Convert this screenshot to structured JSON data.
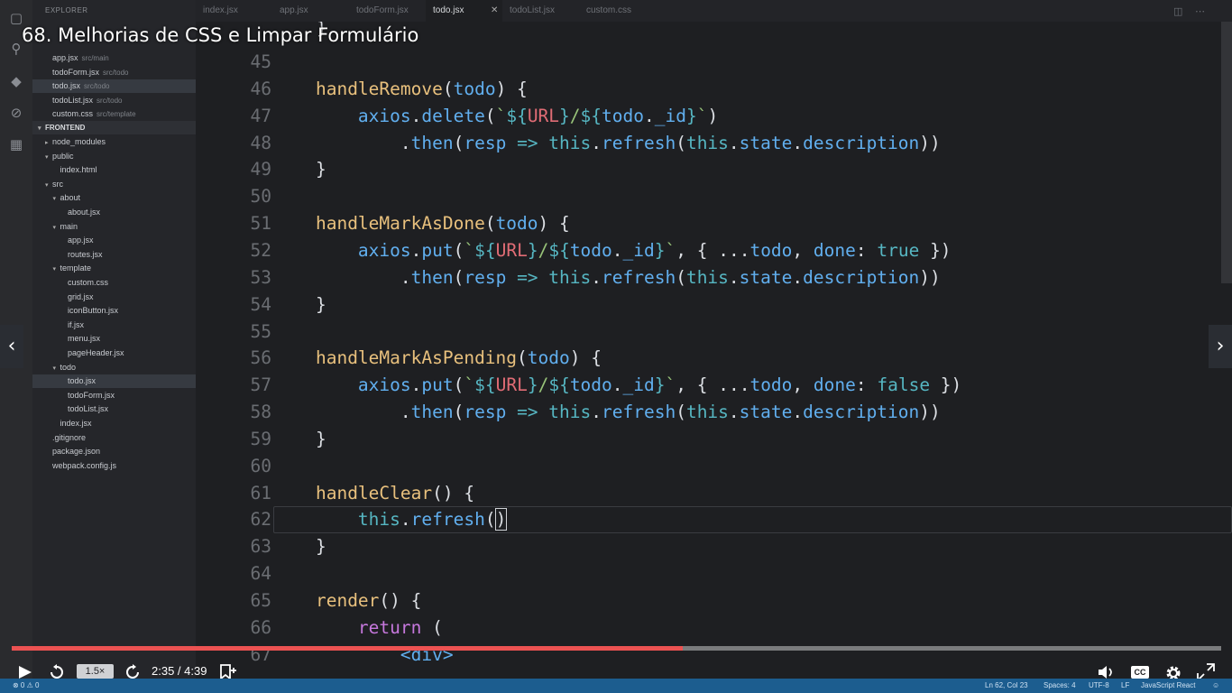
{
  "video": {
    "title": "68. Melhorias de CSS e Limpar Formulário",
    "speed": "1.5×",
    "time": "2:35 / 4:39",
    "progress": 0.555,
    "cc_label": "CC",
    "accent": "#ec5252"
  },
  "sidebar": {
    "header": "EXPLORER",
    "open_editors": [
      {
        "name": "app.jsx",
        "path": "src/main"
      },
      {
        "name": "todoForm.jsx",
        "path": "src/todo"
      },
      {
        "name": "todo.jsx",
        "path": "src/todo",
        "selected": true
      },
      {
        "name": "todoList.jsx",
        "path": "src/todo"
      },
      {
        "name": "custom.css",
        "path": "src/template"
      }
    ],
    "section": "FRONTEND",
    "tree": [
      {
        "name": "node_modules",
        "level": 0,
        "type": "folder-closed"
      },
      {
        "name": "public",
        "level": 0,
        "type": "folder-open"
      },
      {
        "name": "index.html",
        "level": 1,
        "type": "file"
      },
      {
        "name": "src",
        "level": 0,
        "type": "folder-open"
      },
      {
        "name": "about",
        "level": 1,
        "type": "folder-open"
      },
      {
        "name": "about.jsx",
        "level": 2,
        "type": "file"
      },
      {
        "name": "main",
        "level": 1,
        "type": "folder-open"
      },
      {
        "name": "app.jsx",
        "level": 2,
        "type": "file"
      },
      {
        "name": "routes.jsx",
        "level": 2,
        "type": "file"
      },
      {
        "name": "template",
        "level": 1,
        "type": "folder-open"
      },
      {
        "name": "custom.css",
        "level": 2,
        "type": "file"
      },
      {
        "name": "grid.jsx",
        "level": 2,
        "type": "file"
      },
      {
        "name": "iconButton.jsx",
        "level": 2,
        "type": "file"
      },
      {
        "name": "if.jsx",
        "level": 2,
        "type": "file"
      },
      {
        "name": "menu.jsx",
        "level": 2,
        "type": "file"
      },
      {
        "name": "pageHeader.jsx",
        "level": 2,
        "type": "file"
      },
      {
        "name": "todo",
        "level": 1,
        "type": "folder-open"
      },
      {
        "name": "todo.jsx",
        "level": 2,
        "type": "file",
        "selected": true
      },
      {
        "name": "todoForm.jsx",
        "level": 2,
        "type": "file"
      },
      {
        "name": "todoList.jsx",
        "level": 2,
        "type": "file"
      },
      {
        "name": "index.jsx",
        "level": 1,
        "type": "file"
      },
      {
        "name": ".gitignore",
        "level": 0,
        "type": "file"
      },
      {
        "name": "package.json",
        "level": 0,
        "type": "file"
      },
      {
        "name": "webpack.config.js",
        "level": 0,
        "type": "file"
      }
    ]
  },
  "tabs": [
    "index.jsx",
    "app.jsx",
    "todoForm.jsx",
    "todo.jsx",
    "todoList.jsx",
    "custom.css"
  ],
  "active_tab": "todo.jsx",
  "editor": {
    "lines": [
      {
        "n": "45",
        "tokens": []
      },
      {
        "n": "46",
        "tokens": [
          [
            "    ",
            "pun"
          ],
          [
            "handleRemove",
            "fn"
          ],
          [
            "(",
            "pun"
          ],
          [
            "todo",
            "prop"
          ],
          [
            ") {",
            "pun"
          ]
        ]
      },
      {
        "n": "47",
        "tokens": [
          [
            "        ",
            "pun"
          ],
          [
            "axios",
            "prop"
          ],
          [
            ".",
            "pun"
          ],
          [
            "delete",
            "prop"
          ],
          [
            "(",
            "pun"
          ],
          [
            "`",
            "str"
          ],
          [
            "${",
            "tpl"
          ],
          [
            "URL",
            "var"
          ],
          [
            "}",
            "tpl"
          ],
          [
            "/",
            "str"
          ],
          [
            "${",
            "tpl"
          ],
          [
            "todo",
            "prop"
          ],
          [
            ".",
            "pun"
          ],
          [
            "_id",
            "prop"
          ],
          [
            "}",
            "tpl"
          ],
          [
            "`",
            "str"
          ],
          [
            ")",
            "pun"
          ]
        ]
      },
      {
        "n": "48",
        "tokens": [
          [
            "            .",
            "pun"
          ],
          [
            "then",
            "prop"
          ],
          [
            "(",
            "pun"
          ],
          [
            "resp",
            "prop"
          ],
          [
            " ",
            "pun"
          ],
          [
            "=>",
            "arrow"
          ],
          [
            " ",
            "pun"
          ],
          [
            "this",
            "const"
          ],
          [
            ".",
            "pun"
          ],
          [
            "refresh",
            "prop"
          ],
          [
            "(",
            "pun"
          ],
          [
            "this",
            "const"
          ],
          [
            ".",
            "pun"
          ],
          [
            "state",
            "prop"
          ],
          [
            ".",
            "pun"
          ],
          [
            "description",
            "prop"
          ],
          [
            "))",
            "pun"
          ]
        ]
      },
      {
        "n": "49",
        "tokens": [
          [
            "    }",
            "pun"
          ]
        ]
      },
      {
        "n": "50",
        "tokens": []
      },
      {
        "n": "51",
        "tokens": [
          [
            "    ",
            "pun"
          ],
          [
            "handleMarkAsDone",
            "fn"
          ],
          [
            "(",
            "pun"
          ],
          [
            "todo",
            "prop"
          ],
          [
            ") {",
            "pun"
          ]
        ]
      },
      {
        "n": "52",
        "tokens": [
          [
            "        ",
            "pun"
          ],
          [
            "axios",
            "prop"
          ],
          [
            ".",
            "pun"
          ],
          [
            "put",
            "prop"
          ],
          [
            "(",
            "pun"
          ],
          [
            "`",
            "str"
          ],
          [
            "${",
            "tpl"
          ],
          [
            "URL",
            "var"
          ],
          [
            "}",
            "tpl"
          ],
          [
            "/",
            "str"
          ],
          [
            "${",
            "tpl"
          ],
          [
            "todo",
            "prop"
          ],
          [
            ".",
            "pun"
          ],
          [
            "_id",
            "prop"
          ],
          [
            "}",
            "tpl"
          ],
          [
            "`",
            "str"
          ],
          [
            ", { ...",
            "pun"
          ],
          [
            "todo",
            "prop"
          ],
          [
            ", ",
            "pun"
          ],
          [
            "done",
            "prop"
          ],
          [
            ": ",
            "pun"
          ],
          [
            "true",
            "const"
          ],
          [
            " })",
            "pun"
          ]
        ]
      },
      {
        "n": "53",
        "tokens": [
          [
            "            .",
            "pun"
          ],
          [
            "then",
            "prop"
          ],
          [
            "(",
            "pun"
          ],
          [
            "resp",
            "prop"
          ],
          [
            " ",
            "pun"
          ],
          [
            "=>",
            "arrow"
          ],
          [
            " ",
            "pun"
          ],
          [
            "this",
            "const"
          ],
          [
            ".",
            "pun"
          ],
          [
            "refresh",
            "prop"
          ],
          [
            "(",
            "pun"
          ],
          [
            "this",
            "const"
          ],
          [
            ".",
            "pun"
          ],
          [
            "state",
            "prop"
          ],
          [
            ".",
            "pun"
          ],
          [
            "description",
            "prop"
          ],
          [
            "))",
            "pun"
          ]
        ]
      },
      {
        "n": "54",
        "tokens": [
          [
            "    }",
            "pun"
          ]
        ]
      },
      {
        "n": "55",
        "tokens": []
      },
      {
        "n": "56",
        "tokens": [
          [
            "    ",
            "pun"
          ],
          [
            "handleMarkAsPending",
            "fn"
          ],
          [
            "(",
            "pun"
          ],
          [
            "todo",
            "prop"
          ],
          [
            ") {",
            "pun"
          ]
        ]
      },
      {
        "n": "57",
        "tokens": [
          [
            "        ",
            "pun"
          ],
          [
            "axios",
            "prop"
          ],
          [
            ".",
            "pun"
          ],
          [
            "put",
            "prop"
          ],
          [
            "(",
            "pun"
          ],
          [
            "`",
            "str"
          ],
          [
            "${",
            "tpl"
          ],
          [
            "URL",
            "var"
          ],
          [
            "}",
            "tpl"
          ],
          [
            "/",
            "str"
          ],
          [
            "${",
            "tpl"
          ],
          [
            "todo",
            "prop"
          ],
          [
            ".",
            "pun"
          ],
          [
            "_id",
            "prop"
          ],
          [
            "}",
            "tpl"
          ],
          [
            "`",
            "str"
          ],
          [
            ", { ...",
            "pun"
          ],
          [
            "todo",
            "prop"
          ],
          [
            ", ",
            "pun"
          ],
          [
            "done",
            "prop"
          ],
          [
            ": ",
            "pun"
          ],
          [
            "false",
            "const"
          ],
          [
            " })",
            "pun"
          ]
        ]
      },
      {
        "n": "58",
        "tokens": [
          [
            "            .",
            "pun"
          ],
          [
            "then",
            "prop"
          ],
          [
            "(",
            "pun"
          ],
          [
            "resp",
            "prop"
          ],
          [
            " ",
            "pun"
          ],
          [
            "=>",
            "arrow"
          ],
          [
            " ",
            "pun"
          ],
          [
            "this",
            "const"
          ],
          [
            ".",
            "pun"
          ],
          [
            "refresh",
            "prop"
          ],
          [
            "(",
            "pun"
          ],
          [
            "this",
            "const"
          ],
          [
            ".",
            "pun"
          ],
          [
            "state",
            "prop"
          ],
          [
            ".",
            "pun"
          ],
          [
            "description",
            "prop"
          ],
          [
            "))",
            "pun"
          ]
        ]
      },
      {
        "n": "59",
        "tokens": [
          [
            "    }",
            "pun"
          ]
        ]
      },
      {
        "n": "60",
        "tokens": []
      },
      {
        "n": "61",
        "tokens": [
          [
            "    ",
            "pun"
          ],
          [
            "handleClear",
            "fn"
          ],
          [
            "() {",
            "pun"
          ]
        ]
      },
      {
        "n": "62",
        "tokens": [
          [
            "        ",
            "pun"
          ],
          [
            "this",
            "const"
          ],
          [
            ".",
            "pun"
          ],
          [
            "refresh",
            "prop"
          ],
          [
            "(",
            "pun"
          ],
          [
            ")",
            "cursor"
          ]
        ]
      },
      {
        "n": "63",
        "tokens": [
          [
            "    }",
            "pun"
          ]
        ]
      },
      {
        "n": "64",
        "tokens": []
      },
      {
        "n": "65",
        "tokens": [
          [
            "    ",
            "pun"
          ],
          [
            "render",
            "fn"
          ],
          [
            "() {",
            "pun"
          ]
        ]
      },
      {
        "n": "66",
        "tokens": [
          [
            "        ",
            "pun"
          ],
          [
            "return",
            "kw"
          ],
          [
            " (",
            "pun"
          ]
        ]
      },
      {
        "n": "67",
        "tokens": [
          [
            "            ",
            "pun"
          ],
          [
            "<div>",
            "tag"
          ]
        ]
      }
    ]
  },
  "statusbar": {
    "left": "⊗ 0  ⚠ 0",
    "position": "Ln 62, Col 23",
    "spaces": "Spaces: 4",
    "encoding": "UTF-8",
    "eol": "LF",
    "language": "JavaScript React"
  }
}
